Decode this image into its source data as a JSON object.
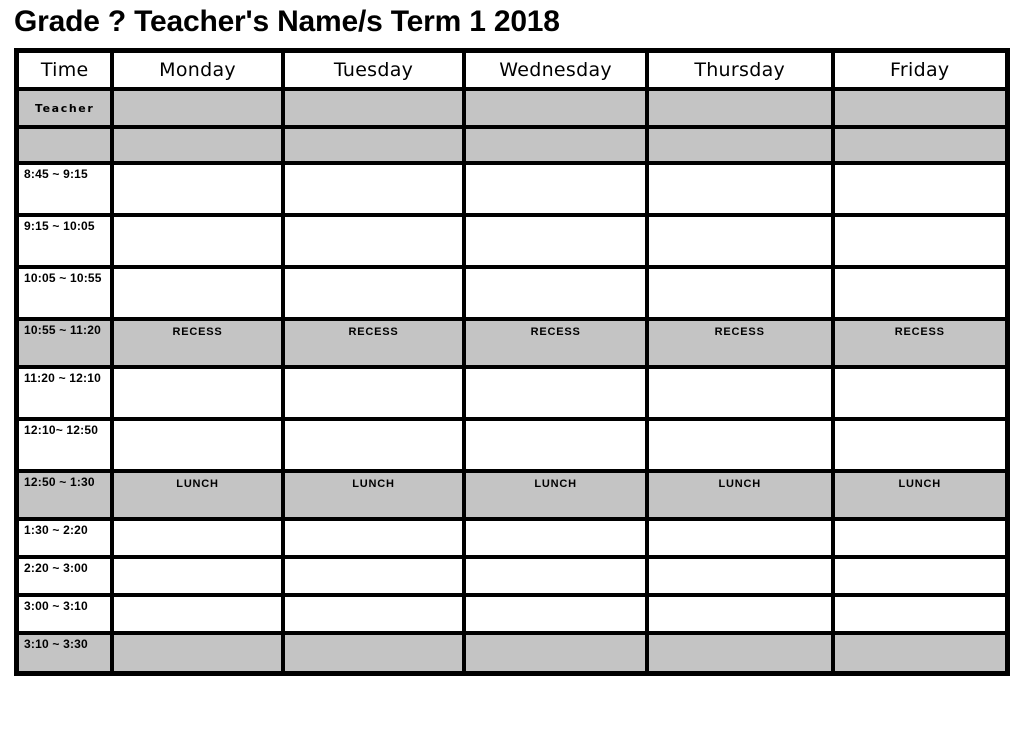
{
  "page": {
    "title": "Grade ? Teacher's Name/s Term 1 2018",
    "background_color": "#ffffff",
    "grid_color": "#000000",
    "shaded_cell_color": "#c4c4c4"
  },
  "table": {
    "columns": [
      {
        "key": "time",
        "label": "Time"
      },
      {
        "key": "monday",
        "label": "Monday"
      },
      {
        "key": "tuesday",
        "label": "Tuesday"
      },
      {
        "key": "wednesday",
        "label": "Wednesday"
      },
      {
        "key": "thursday",
        "label": "Thursday"
      },
      {
        "key": "friday",
        "label": "Friday"
      }
    ],
    "rows": [
      {
        "kind": "teacher",
        "time_label": "Teacher",
        "shaded": true,
        "cells": [
          "",
          "",
          "",
          "",
          ""
        ]
      },
      {
        "kind": "blank",
        "time_label": "",
        "shaded": true,
        "cells": [
          "",
          "",
          "",
          "",
          ""
        ]
      },
      {
        "kind": "period",
        "time_label": "8:45 ~ 9:15",
        "shaded": false,
        "cells": [
          "",
          "",
          "",
          "",
          ""
        ]
      },
      {
        "kind": "period",
        "time_label": "9:15 ~ 10:05",
        "shaded": false,
        "cells": [
          "",
          "",
          "",
          "",
          ""
        ]
      },
      {
        "kind": "period",
        "time_label": "10:05 ~ 10:55",
        "shaded": false,
        "cells": [
          "",
          "",
          "",
          "",
          ""
        ]
      },
      {
        "kind": "break",
        "time_label": "10:55 ~ 11:20",
        "shaded": true,
        "cells": [
          "RECESS",
          "RECESS",
          "RECESS",
          "RECESS",
          "RECESS"
        ]
      },
      {
        "kind": "period",
        "time_label": "11:20 ~ 12:10",
        "shaded": false,
        "cells": [
          "",
          "",
          "",
          "",
          ""
        ]
      },
      {
        "kind": "period",
        "time_label": "12:10~ 12:50",
        "shaded": false,
        "cells": [
          "",
          "",
          "",
          "",
          ""
        ]
      },
      {
        "kind": "break",
        "time_label": "12:50 ~ 1:30",
        "shaded": true,
        "cells": [
          "LUNCH",
          "LUNCH",
          "LUNCH",
          "LUNCH",
          "LUNCH"
        ]
      },
      {
        "kind": "short",
        "time_label": "1:30 ~ 2:20",
        "shaded": false,
        "cells": [
          "",
          "",
          "",
          "",
          ""
        ]
      },
      {
        "kind": "short",
        "time_label": "2:20 ~ 3:00",
        "shaded": false,
        "cells": [
          "",
          "",
          "",
          "",
          ""
        ]
      },
      {
        "kind": "short",
        "time_label": "3:00 ~ 3:10",
        "shaded": false,
        "cells": [
          "",
          "",
          "",
          "",
          ""
        ]
      },
      {
        "kind": "last",
        "time_label": "3:10 ~ 3:30",
        "shaded": true,
        "cells": [
          "",
          "",
          "",
          "",
          ""
        ]
      }
    ]
  }
}
